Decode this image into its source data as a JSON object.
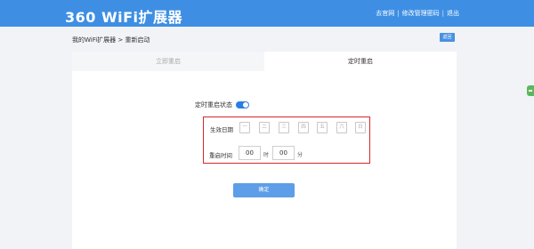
{
  "header": {
    "logo": "360 WiFi扩展器",
    "links": [
      "去官网",
      "修改管理密码",
      "退出"
    ],
    "brand_color": "#3e8fe4"
  },
  "breadcrumb": "我的WiFi扩展器 >  重新启动",
  "back_label": "返回",
  "tabs": [
    {
      "label": "立即重启",
      "active": false
    },
    {
      "label": "定时重启",
      "active": true
    }
  ],
  "schedule": {
    "status_label": "定时重启状态",
    "enabled": true,
    "days_label": "生效日期",
    "days": [
      "一",
      "二",
      "三",
      "四",
      "五",
      "六",
      "日"
    ],
    "time_label": "重启时间",
    "hour": "00",
    "hour_unit": "时",
    "minute": "00",
    "minute_unit": "分"
  },
  "confirm_label": "确定",
  "highlight_color": "#d9262c"
}
